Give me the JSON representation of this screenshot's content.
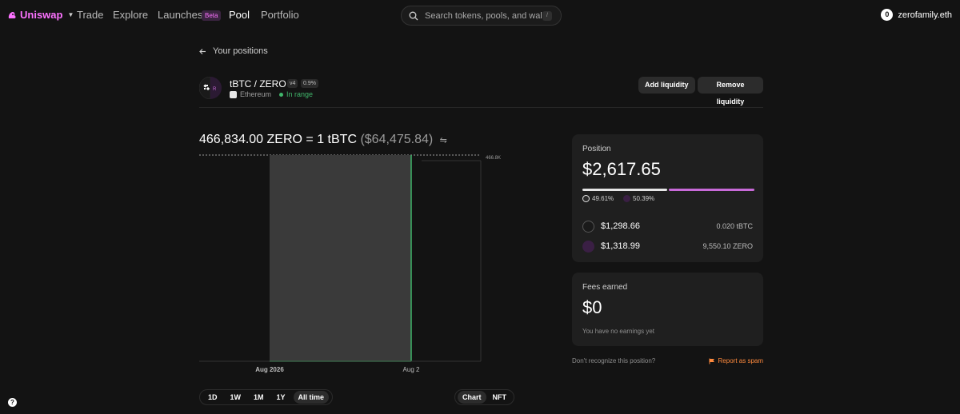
{
  "nav": {
    "brand": "Uniswap",
    "links": [
      {
        "label": "Trade"
      },
      {
        "label": "Explore"
      },
      {
        "label": "Launches"
      },
      {
        "label": "Pool"
      },
      {
        "label": "Portfolio"
      }
    ],
    "beta_badge": "Beta",
    "search_placeholder": "Search tokens, pools, and wall…",
    "search_shortcut": "/",
    "account": "zerofamily.eth",
    "account_avatar": "0"
  },
  "back_label": "Your positions",
  "pool": {
    "pair": "tBTC / ZERO",
    "version": "v4",
    "fee": "0.9%",
    "chain": "Ethereum",
    "status": "In range",
    "add_liquidity": "Add liquidity",
    "remove_liquidity": "Remove liquidity",
    "token_badge": "R"
  },
  "price": {
    "quote": "466,834.00 ZERO = 1 tBTC",
    "usd": "($64,475.84)"
  },
  "chart_data": {
    "type": "area",
    "x_ticks": [
      "Aug 2026",
      "Aug 2"
    ],
    "y_tick_label": "466.8K",
    "range_shaded": true
  },
  "range_options": [
    "1D",
    "1W",
    "1M",
    "1Y",
    "All time"
  ],
  "range_selected": "All time",
  "view_options": [
    "Chart",
    "NFT"
  ],
  "view_selected": "Chart",
  "position_card": {
    "label": "Position",
    "value": "$2,617.65",
    "token0_pct": "49.61%",
    "token1_pct": "50.39%",
    "token0_usd": "$1,298.66",
    "token0_amount": "0.020 tBTC",
    "token1_usd": "$1,318.99",
    "token1_amount": "9,550.10 ZERO"
  },
  "fees_card": {
    "label": "Fees earned",
    "value": "$0",
    "note": "You have no earnings yet"
  },
  "footer": {
    "question": "Don't recognize this position?",
    "report": "Report as spam"
  },
  "help_icon": "?",
  "colors": {
    "accent_pink": "#fc72ff",
    "in_range_green": "#40b66b",
    "report_orange": "#ff8a3d",
    "background": "#131313",
    "card": "#1f1f1f"
  }
}
